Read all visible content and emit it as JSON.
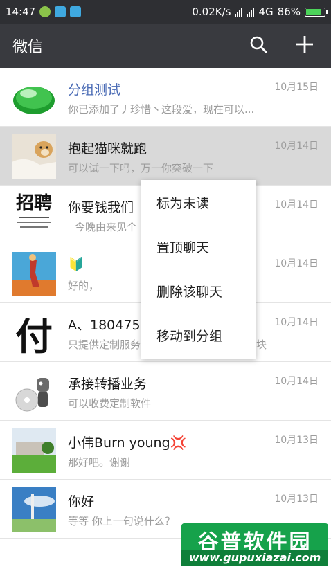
{
  "status_bar": {
    "time": "14:47",
    "speed": "0.02K/s",
    "network": "4G",
    "battery_percent": "86%",
    "battery_level": 0.86
  },
  "app_bar": {
    "title": "微信",
    "search_icon": "search-icon",
    "add_icon": "plus-icon"
  },
  "chats": [
    {
      "name": "分组测试",
      "time": "10月15日",
      "preview": "你已添加了丿珍惜丶这段爱，现在可以..."
    },
    {
      "name": "抱起猫咪就跑",
      "time": "10月14日",
      "preview": "可以试一下吗，万一你突破一下"
    },
    {
      "name": "你要钱我们",
      "time": "10月14日",
      "preview": "今晚由来见个"
    },
    {
      "name": "🔰",
      "time": "10月14日",
      "preview": "好的，"
    },
    {
      "name": "A、180475",
      "time": "10月14日",
      "preview": "只提供定制服务",
      "preview_tail": "块"
    },
    {
      "name": "承接转播业务",
      "time": "10月14日",
      "preview": "可以收费定制软件"
    },
    {
      "name": "小伟Burn young💢",
      "time": "10月13日",
      "preview": "那好吧。谢谢"
    },
    {
      "name": "你好",
      "time": "10月13日",
      "preview": "等等   你上一句说什么？"
    }
  ],
  "avatar_texts": {
    "zhaopin": "招聘",
    "fu": "付"
  },
  "context_menu": {
    "items": [
      "标为未读",
      "置顶聊天",
      "删除该聊天",
      "移动到分组"
    ]
  },
  "watermark": {
    "title": "谷普软件园",
    "url": "www.gupuxiazai.com"
  },
  "colors": {
    "status_bar": "#2e2f33",
    "app_bar": "#393a3f",
    "pressed_row": "#d9d9d9",
    "group_name": "#4a6bb5",
    "watermark": "#16a24b"
  }
}
